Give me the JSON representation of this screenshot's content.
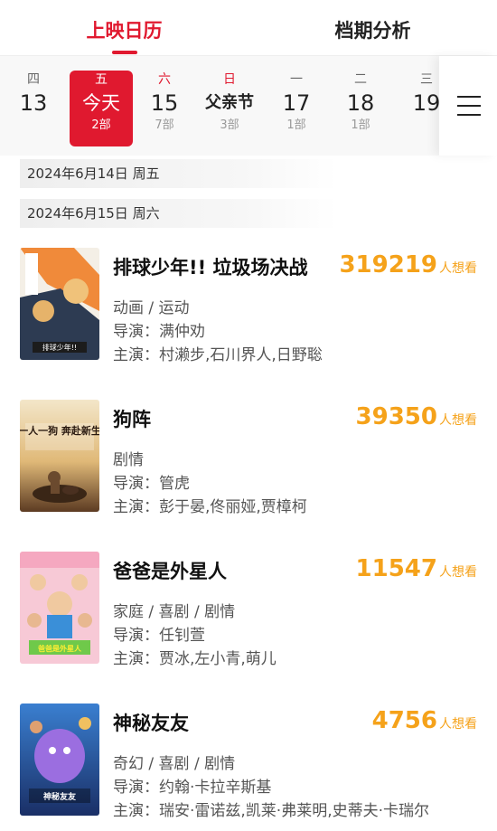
{
  "tabs": {
    "calendar": "上映日历",
    "analysis": "档期分析"
  },
  "days": [
    {
      "weekday": "四",
      "date": "13",
      "count": ""
    },
    {
      "weekday": "五",
      "date": "今天",
      "count": "2部"
    },
    {
      "weekday": "六",
      "date": "15",
      "count": "7部"
    },
    {
      "weekday": "日",
      "date": "父亲节",
      "count": "3部"
    },
    {
      "weekday": "一",
      "date": "17",
      "count": "1部"
    },
    {
      "weekday": "二",
      "date": "18",
      "count": "1部"
    },
    {
      "weekday": "三",
      "date": "19",
      "count": ""
    }
  ],
  "date_headers": [
    "2024年6月14日  周五",
    "2024年6月15日  周六"
  ],
  "films": [
    {
      "title": "排球少年!! 垃圾场决战",
      "want_count": "319219",
      "want_label": "人想看",
      "genre": "动画 / 运动",
      "director": "导演：满仲劝",
      "cast": "主演：村濑步,石川界人,日野聡"
    },
    {
      "title": "狗阵",
      "want_count": "39350",
      "want_label": "人想看",
      "genre": "剧情",
      "director": "导演：管虎",
      "cast": "主演：彭于晏,佟丽娅,贾樟柯"
    },
    {
      "title": "爸爸是外星人",
      "want_count": "11547",
      "want_label": "人想看",
      "genre": "家庭 / 喜剧 / 剧情",
      "director": "导演：任钊萱",
      "cast": "主演：贾冰,左小青,萌儿"
    },
    {
      "title": "神秘友友",
      "want_count": "4756",
      "want_label": "人想看",
      "genre": "奇幻 / 喜剧 / 剧情",
      "director": "导演：约翰·卡拉辛斯基",
      "cast": "主演：瑞安·雷诺兹,凯莱·弗莱明,史蒂夫·卡瑞尔"
    }
  ],
  "posters": [
    {
      "text": "排球少年!!"
    },
    {
      "text": "一人一狗 奔赴新生"
    },
    {
      "text": "爸爸是外星人"
    },
    {
      "text": "神秘友友"
    }
  ],
  "colors": {
    "accent": "#e0192f",
    "want": "#f5a21a"
  }
}
